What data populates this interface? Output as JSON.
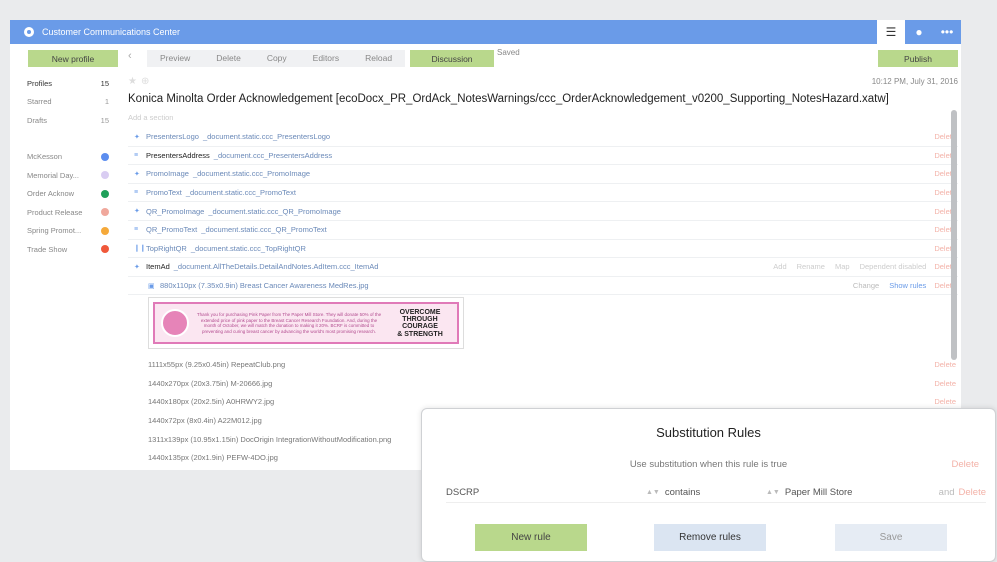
{
  "app": {
    "title": "Customer Communications Center"
  },
  "topbar": {
    "icons": [
      "menu-icon",
      "user-icon",
      "more-icon"
    ]
  },
  "toolbar": {
    "new_profile": "New profile",
    "preview": "Preview",
    "delete": "Delete",
    "copy": "Copy",
    "editors": "Editors",
    "reload": "Reload",
    "discussion": "Discussion",
    "saved": "Saved",
    "publish": "Publish"
  },
  "sidebar": {
    "main": [
      {
        "label": "Profiles",
        "count": "15"
      },
      {
        "label": "Starred",
        "count": "1"
      },
      {
        "label": "Drafts",
        "count": "15"
      }
    ],
    "tags": [
      {
        "label": "McKesson",
        "color": "#5b8def"
      },
      {
        "label": "Memorial Day...",
        "color": "#d9cdf2"
      },
      {
        "label": "Order Acknow",
        "color": "#1fa05a"
      },
      {
        "label": "Product Release",
        "color": "#f0a89c"
      },
      {
        "label": "Spring Promot...",
        "color": "#f5a93a"
      },
      {
        "label": "Trade Show",
        "color": "#f0583a"
      }
    ]
  },
  "document": {
    "date": "10:12 PM, July 31, 2016",
    "title": "Konica Minolta Order Acknowledgement [ecoDocx_PR_OrdAck_NotesWarnings/ccc_OrderAcknowledgement_v0200_Supporting_NotesHazard.xatw]",
    "add_section": "Add a section",
    "delete_label": "Delete",
    "sections": [
      {
        "name": "PresentersLogo",
        "path": "_document.static.ccc_PresentersLogo",
        "icon": "image-icon"
      },
      {
        "name": "PresentersAddress",
        "path": "_document.ccc_PresentersAddress",
        "icon": "text-icon"
      },
      {
        "name": "PromoImage",
        "path": "_document.static.ccc_PromoImage",
        "icon": "image-icon"
      },
      {
        "name": "PromoText",
        "path": "_document.static.ccc_PromoText",
        "icon": "text-icon"
      },
      {
        "name": "QR_PromoImage",
        "path": "_document.static.ccc_QR_PromoImage",
        "icon": "image-icon"
      },
      {
        "name": "QR_PromoText",
        "path": "_document.static.ccc_QR_PromoText",
        "icon": "text-icon"
      },
      {
        "name": "TopRightQR",
        "path": "_document.static.ccc_TopRightQR",
        "icon": "barcode-icon"
      }
    ],
    "item_ad": {
      "name": "ItemAd",
      "path": "_document.AllTheDetails.DetailAndNotes.AdItem.ccc_ItemAd",
      "actions": [
        "Add",
        "Rename",
        "Map",
        "Dependent disabled"
      ]
    },
    "first_file": {
      "label": "880x110px (7.35x0.9in) Breast Cancer Awareness MedRes.jpg",
      "change": "Change",
      "show_rules": "Show rules"
    },
    "files": [
      "1111x55px (9.25x0.45in) RepeatClub.png",
      "1440x270px (20x3.75in) M-20666.jpg",
      "1440x180px (20x2.5in) A0HRWY2.jpg",
      "1440x72px (8x0.4in) A22M012.jpg",
      "1311x139px (10.95x1.15in) DocOrigin IntegrationWithoutModification.png",
      "1440x135px (20x1.9in) PEFW-4DO.jpg"
    ]
  },
  "banner": {
    "text": "Thank you for purchasing Pink Paper from The Paper Mill Store. They will donate 50% of the extended price of pink paper to the Breast Cancer Research Foundation. And, during the month of October, we will match the donation to making it 20%. BCRF is committed to preventing and curing breast cancer by advancing the world's most promising research.",
    "slogan": [
      "OVERCOME",
      "THROUGH",
      "COURAGE",
      "& STRENGTH"
    ]
  },
  "modal": {
    "title": "Substitution Rules",
    "subtitle": "Use substitution when this rule is true",
    "delete": "Delete",
    "rule": {
      "field": "DSCRP",
      "operator": "contains",
      "value": "Paper Mill Store",
      "and": "and",
      "delete": "Delete"
    },
    "new_rule": "New rule",
    "remove_rules": "Remove rules",
    "save": "Save"
  }
}
